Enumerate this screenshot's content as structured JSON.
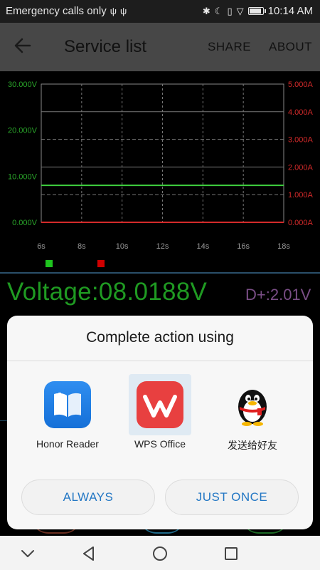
{
  "status_bar": {
    "carrier": "Emergency calls only",
    "time": "10:14 AM",
    "battery_level": 0.8
  },
  "app_bar": {
    "title": "Service list",
    "share_label": "SHARE",
    "about_label": "ABOUT"
  },
  "chart_data": {
    "type": "line",
    "x": [
      6,
      8,
      10,
      12,
      14,
      16,
      18
    ],
    "x_tick_labels": [
      "6s",
      "8s",
      "10s",
      "12s",
      "14s",
      "16s",
      "18s"
    ],
    "y_left_ticks": [
      "0.000V",
      "10.000V",
      "20.000V",
      "30.000V"
    ],
    "y_left_range": [
      0,
      30
    ],
    "y_right_ticks": [
      "0.000A",
      "1.000A",
      "2.000A",
      "3.000A",
      "4.000A",
      "5.000A"
    ],
    "y_right_range": [
      0,
      5
    ],
    "series": [
      {
        "axis": "left",
        "color": "#3ecf3e",
        "values": [
          8.0188,
          8.0188,
          8.0188,
          8.0188,
          8.0188,
          8.0188,
          8.0188
        ]
      },
      {
        "axis": "right",
        "color": "#d42a2a",
        "values": [
          0,
          0,
          0,
          0,
          0,
          0,
          0
        ]
      }
    ],
    "grid": true,
    "legend_colors": [
      "#1ec41e",
      "#d00000"
    ],
    "legend_placement": "bottom-left"
  },
  "readout": {
    "voltage": "Voltage:08.0188V",
    "dplus": "D+:2.01V"
  },
  "dialog": {
    "title": "Complete action using",
    "apps": [
      {
        "label": "Honor Reader",
        "icon": "book-icon"
      },
      {
        "label": "WPS Office",
        "icon": "wps-icon"
      },
      {
        "label": "发送给好友",
        "icon": "qq-penguin-icon"
      }
    ],
    "always_label": "ALWAYS",
    "once_label": "JUST ONCE"
  },
  "colors": {
    "voltage": "#1f9a22",
    "current": "#d42a2a",
    "dialog_button_text": "#2377c4"
  }
}
